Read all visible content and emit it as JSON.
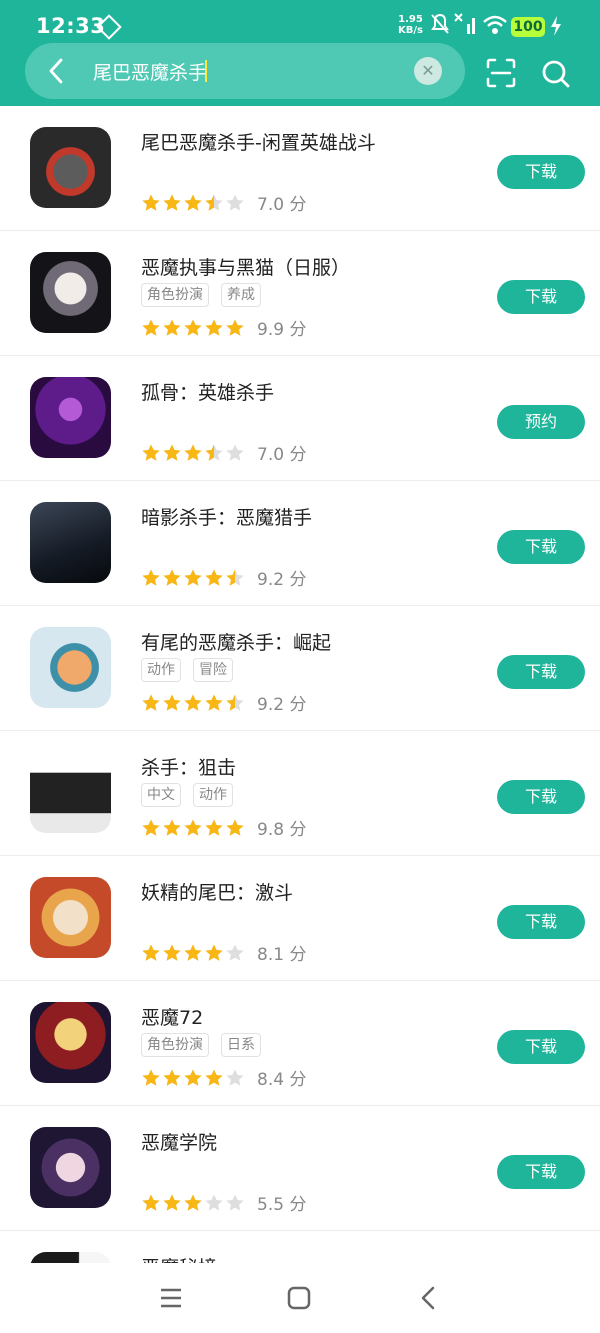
{
  "status": {
    "time": "12:33",
    "net_speed": "1.95",
    "net_unit": "KB/s",
    "battery": "100"
  },
  "search": {
    "query": "尾巴恶魔杀手"
  },
  "colors": {
    "primary": "#1fb59b",
    "star": "#f9b715",
    "star_empty": "#dedede"
  },
  "apps": [
    {
      "title": "尾巴恶魔杀手-闲置英雄战斗",
      "tags": [],
      "rating": 3.5,
      "score": "7.0 分",
      "button": "下载"
    },
    {
      "title": "恶魔执事与黑猫（日服）",
      "tags": [
        "角色扮演",
        "养成"
      ],
      "rating": 5,
      "score": "9.9 分",
      "button": "下载"
    },
    {
      "title": "孤骨：英雄杀手",
      "tags": [],
      "rating": 3.5,
      "score": "7.0 分",
      "button": "预约"
    },
    {
      "title": "暗影杀手：恶魔猎手",
      "tags": [],
      "rating": 4.5,
      "score": "9.2 分",
      "button": "下载"
    },
    {
      "title": "有尾的恶魔杀手：崛起",
      "tags": [
        "动作",
        "冒险"
      ],
      "rating": 4.5,
      "score": "9.2 分",
      "button": "下载"
    },
    {
      "title": "杀手：狙击",
      "tags": [
        "中文",
        "动作"
      ],
      "rating": 5,
      "score": "9.8 分",
      "button": "下载"
    },
    {
      "title": "妖精的尾巴：激斗",
      "tags": [],
      "rating": 4,
      "score": "8.1 分",
      "button": "下载"
    },
    {
      "title": "恶魔72",
      "tags": [
        "角色扮演",
        "日系"
      ],
      "rating": 4,
      "score": "8.4 分",
      "button": "下载"
    },
    {
      "title": "恶魔学院",
      "tags": [],
      "rating": 3,
      "score": "5.5 分",
      "button": "下载"
    },
    {
      "title": "恶魔秘境",
      "tags": [],
      "rating": 0,
      "score": "",
      "button": ""
    }
  ]
}
